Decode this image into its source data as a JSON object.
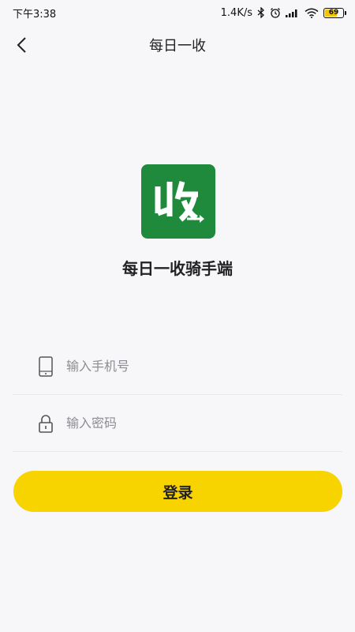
{
  "status_bar": {
    "time": "下午3:38",
    "network_speed": "1.4K/s",
    "battery": 69,
    "icons": [
      "bluetooth-icon",
      "alarm-icon",
      "signal-icon",
      "wifi-icon",
      "battery-icon"
    ]
  },
  "nav": {
    "title": "每日一收",
    "back_icon": "chevron-left-icon"
  },
  "logo": {
    "glyph": "收",
    "bg_color": "#1f8a3b",
    "app_name": "每日一收骑手端"
  },
  "form": {
    "phone": {
      "placeholder": "输入手机号",
      "value": "",
      "icon": "phone-icon"
    },
    "password": {
      "placeholder": "输入密码",
      "value": "",
      "icon": "lock-icon"
    }
  },
  "login_button": {
    "label": "登录",
    "color": "#f7d300"
  }
}
